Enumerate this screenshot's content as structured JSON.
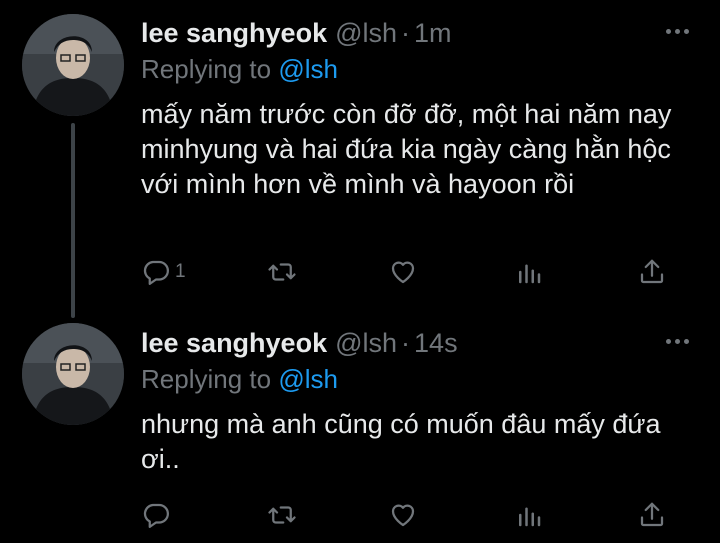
{
  "tweets": [
    {
      "author_name": "lee sanghyeok",
      "handle": "@lsh",
      "separator": "·",
      "time": "1m",
      "replying_prefix": "Replying to",
      "replying_to": "@lsh",
      "text": "mấy năm trước còn đỡ đỡ, một hai năm nay minhyung và hai đứa kia ngày càng hằn hộc với mình hơn về mình và hayoon rồi",
      "reply_count": "1",
      "icons": [
        "reply-icon",
        "retweet-icon",
        "like-icon",
        "analytics-icon",
        "share-icon",
        "more-icon"
      ]
    },
    {
      "author_name": "lee sanghyeok",
      "handle": "@lsh",
      "separator": "·",
      "time": "14s",
      "replying_prefix": "Replying to",
      "replying_to": "@lsh",
      "text": "nhưng mà anh cũng có muốn đâu mấy đứa ơi..",
      "reply_count": "",
      "icons": [
        "reply-icon",
        "retweet-icon",
        "like-icon",
        "analytics-icon",
        "share-icon",
        "more-icon"
      ]
    }
  ],
  "colors": {
    "background": "#000000",
    "primary_text": "#e7e9ea",
    "secondary_text": "#71767b",
    "accent": "#1d9bf0",
    "thread_line": "#3d4348"
  }
}
